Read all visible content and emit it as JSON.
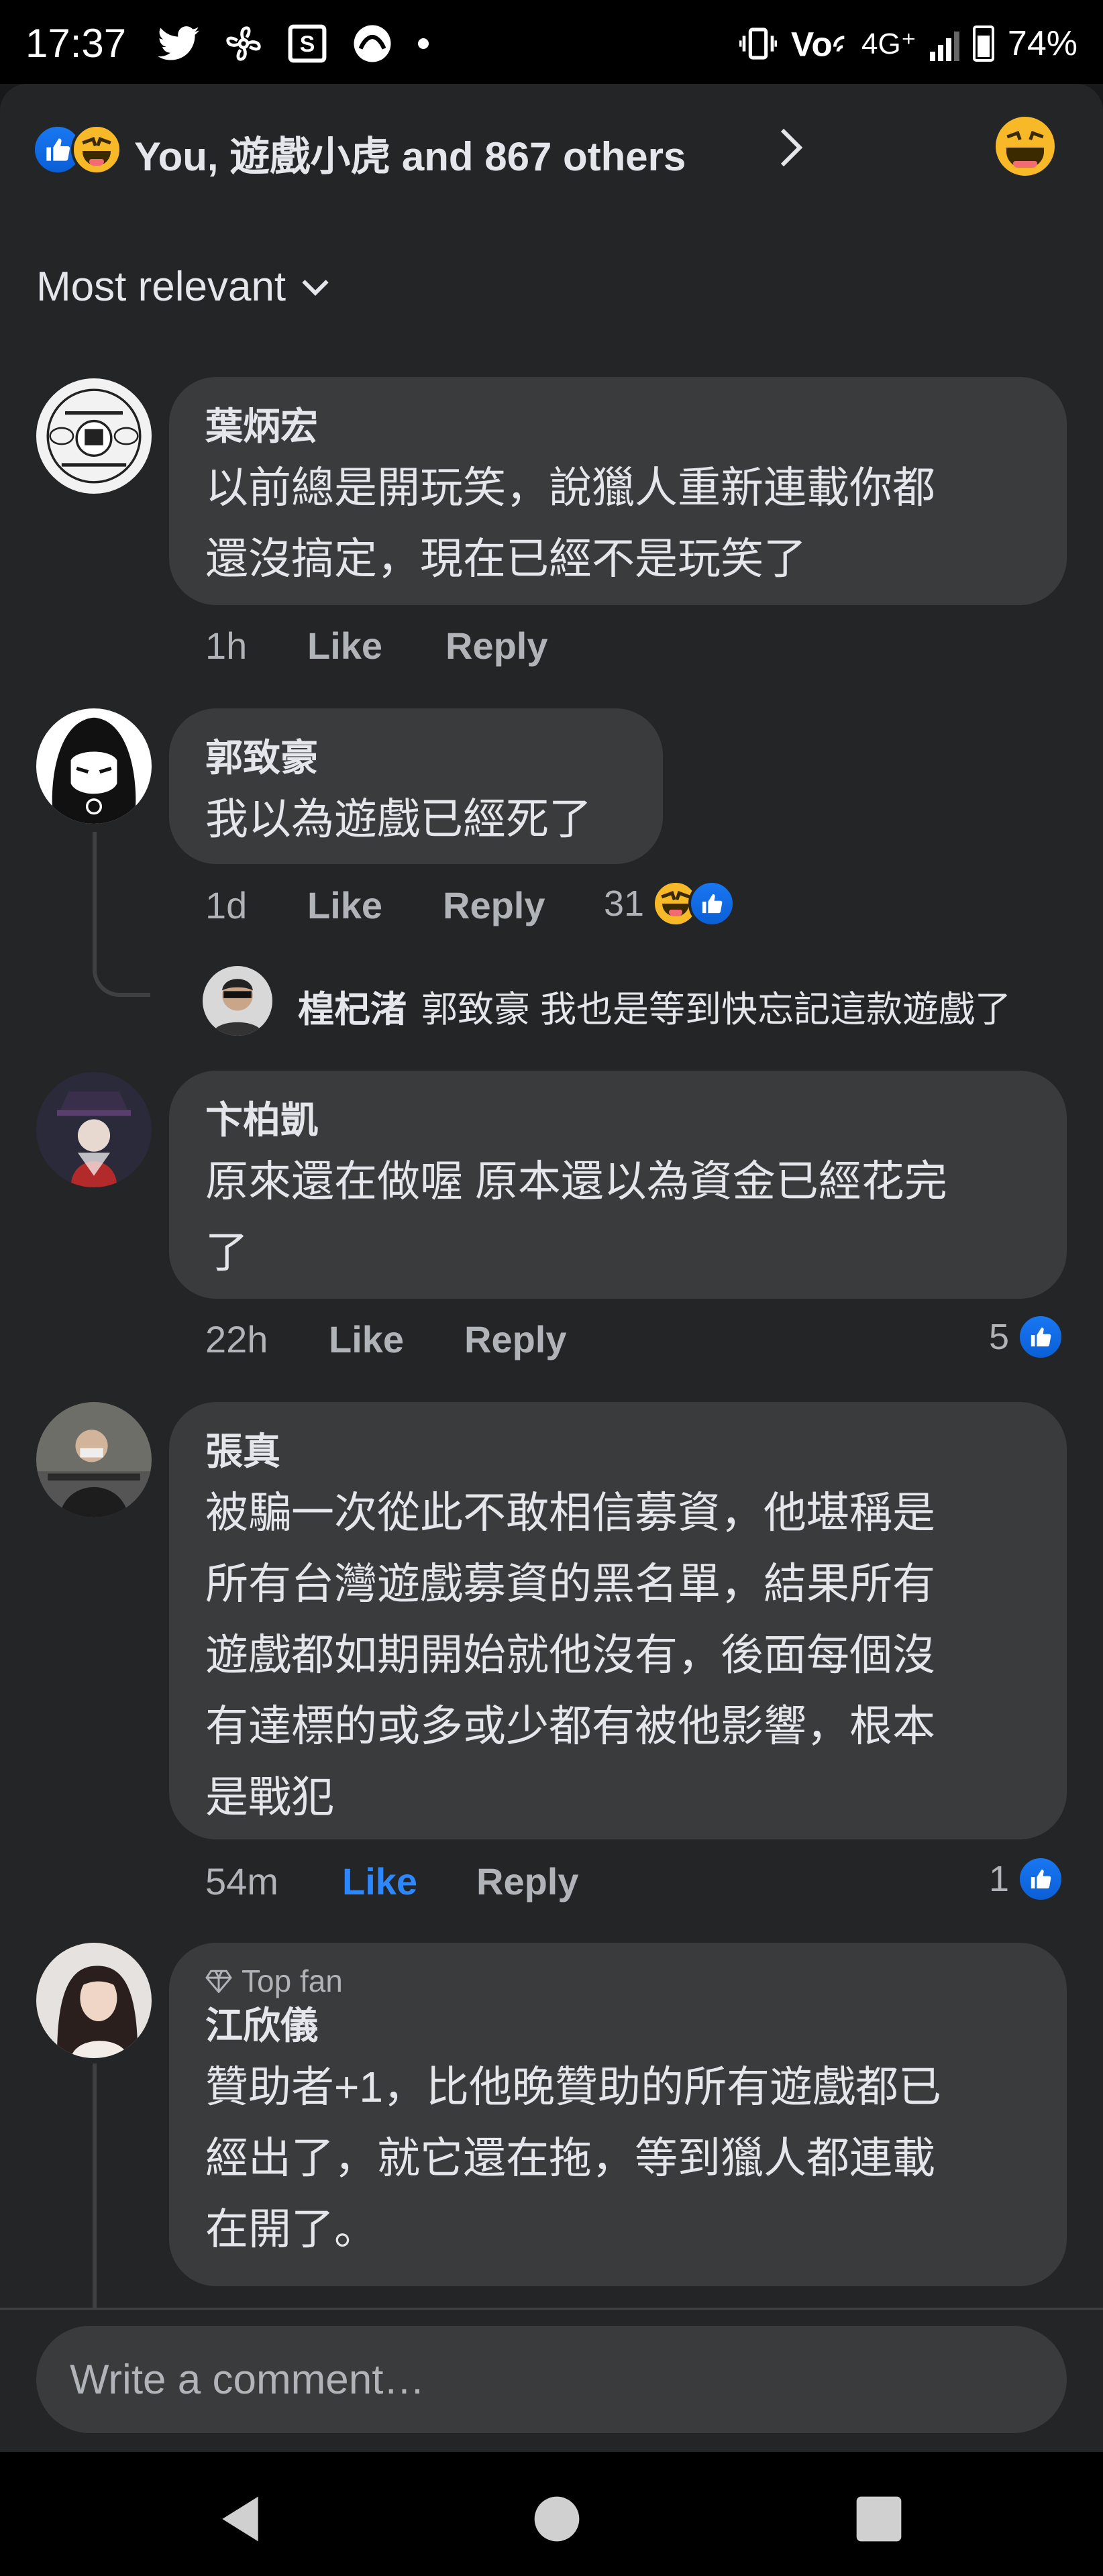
{
  "status_bar": {
    "time": "17:37",
    "network": "4G⁺",
    "battery": "74%"
  },
  "reactions": {
    "summary": "You, 遊戲小虎 and 867 others"
  },
  "sort": {
    "label": "Most relevant"
  },
  "comments": [
    {
      "name": "葉炳宏",
      "lines": [
        "以前總是開玩笑，說獵人重新連載你都",
        "還沒搞定，現在已經不是玩笑了"
      ],
      "time": "1h",
      "like": "Like",
      "reply": "Reply"
    },
    {
      "name": "郭致豪",
      "lines": [
        "我以為遊戲已經死了"
      ],
      "time": "1d",
      "like": "Like",
      "reply": "Reply",
      "reaction_count": "31",
      "reply_preview": {
        "name": "楻杞渚",
        "text": "郭致豪 我也是等到快忘記這款遊戲了"
      }
    },
    {
      "name": "卞柏凱",
      "lines": [
        "原來還在做喔 原本還以為資金已經花完",
        "了"
      ],
      "time": "22h",
      "like": "Like",
      "reply": "Reply",
      "reaction_count": "5"
    },
    {
      "name": "張真",
      "lines": [
        "被騙一次從此不敢相信募資，他堪稱是",
        "所有台灣遊戲募資的黑名單，結果所有",
        "遊戲都如期開始就他沒有，後面每個沒",
        "有達標的或多或少都有被他影響，根本",
        "是戰犯"
      ],
      "time": "54m",
      "like": "Like",
      "reply": "Reply",
      "reaction_count": "1",
      "liked_by_you": true
    },
    {
      "badge": "Top fan",
      "name": "江欣儀",
      "lines": [
        "贊助者+1，比他晚贊助的所有遊戲都已",
        "經出了，就它還在拖，等到獵人都連載",
        "在開了。"
      ]
    }
  ],
  "composer": {
    "placeholder": "Write a comment…"
  },
  "colors": {
    "background": "#242526",
    "bubble": "#3a3b3c",
    "accent_blue": "#2d88ff",
    "haha_yellow": "#f7b928",
    "muted_text": "#b0b3b8"
  },
  "icons": [
    "twitter-icon",
    "fan-icon",
    "sports-app-icon",
    "notification-app-icon",
    "vibrate-icon",
    "volte-icon",
    "signal-icon",
    "battery-icon",
    "like-reaction-icon",
    "haha-reaction-icon",
    "chevron-right-icon",
    "chevron-down-icon",
    "diamond-icon",
    "back-icon",
    "home-icon",
    "recents-icon"
  ]
}
